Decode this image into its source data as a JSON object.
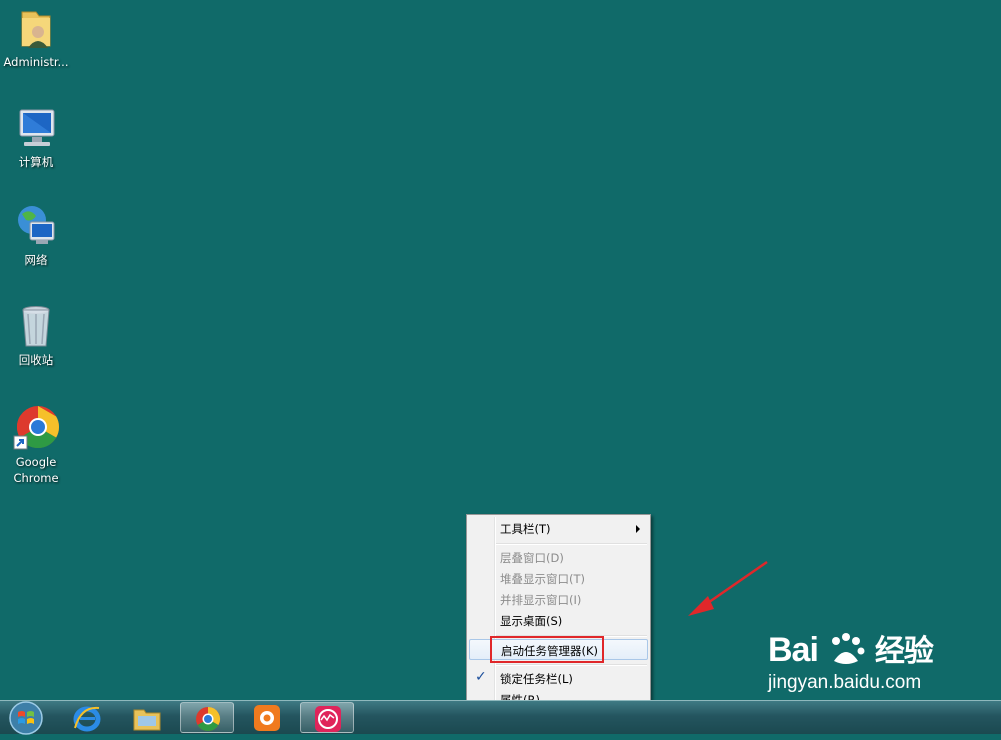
{
  "desktop": {
    "icons": [
      {
        "label": "Administr..."
      },
      {
        "label": "计算机"
      },
      {
        "label": "网络"
      },
      {
        "label": "回收站"
      },
      {
        "label_line1": "Google",
        "label_line2": "Chrome"
      }
    ],
    "background_color": "#106a69"
  },
  "context_menu": {
    "items": [
      {
        "label": "工具栏(T)",
        "has_submenu": true
      },
      {
        "label": "层叠窗口(D)",
        "enabled": false
      },
      {
        "label": "堆叠显示窗口(T)",
        "enabled": false
      },
      {
        "label": "并排显示窗口(I)",
        "enabled": false
      },
      {
        "label": "显示桌面(S)",
        "enabled": true
      },
      {
        "label": "启动任务管理器(K)",
        "highlighted": true
      },
      {
        "label": "锁定任务栏(L)",
        "checked": true
      },
      {
        "label": "属性(R)"
      }
    ],
    "highlight_color": "#e0272a"
  },
  "taskbar": {
    "pinned": [
      "start-orb",
      "internet-explorer",
      "file-explorer",
      "chrome",
      "media-app",
      "monitor-app"
    ],
    "active": "chrome"
  },
  "watermark": {
    "logo_text": "Bai",
    "logo_cn": "经验",
    "site": "jingyan.baidu.com"
  }
}
